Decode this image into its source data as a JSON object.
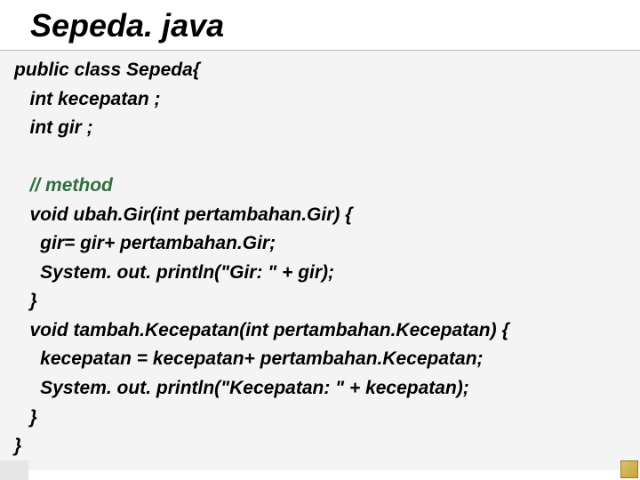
{
  "title": "Sepeda. java",
  "code": {
    "l1": "public class Sepeda{",
    "l2": "   int kecepatan ;",
    "l3": "   int gir ;",
    "blank1": "",
    "l4": "   ",
    "comment": "// method",
    "l5": "   void ubah.Gir(int pertambahan.Gir) {",
    "l6": "     gir= gir+ pertambahan.Gir;",
    "l7": "     System. out. println(\"Gir: \" + gir);",
    "l8": "   }",
    "l9": "   void tambah.Kecepatan(int pertambahan.Kecepatan) {",
    "l10": "     kecepatan = kecepatan+ pertambahan.Kecepatan;",
    "l11": "     System. out. println(\"Kecepatan: \" + kecepatan);",
    "l12": "   }",
    "l13": "}"
  }
}
